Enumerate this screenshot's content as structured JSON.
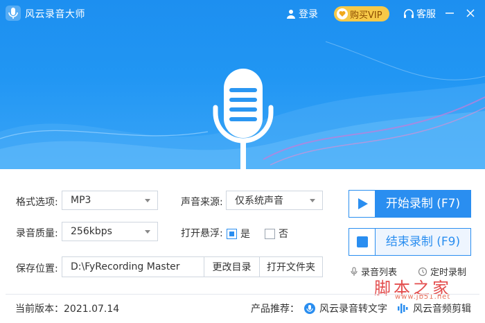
{
  "app": {
    "title": "风云录音大师",
    "login_label": "登录",
    "vip_label": "购买VIP",
    "service_label": "客服"
  },
  "form": {
    "format_label": "格式选项:",
    "format_value": "MP3",
    "quality_label": "录音质量:",
    "quality_value": "256kbps",
    "source_label": "声音来源:",
    "source_value": "仅系统声音",
    "float_label": "打开悬浮:",
    "float_yes": "是",
    "float_no": "否",
    "float_selected": "是",
    "save_label": "保存位置:",
    "save_path": "D:\\FyRecording Master",
    "change_dir_label": "更改目录",
    "open_folder_label": "打开文件夹"
  },
  "actions": {
    "start_label": "开始录制 (F7)",
    "stop_label": "结束录制 (F9)",
    "list_label": "录音列表",
    "timer_label": "定时录制"
  },
  "footer": {
    "version_text": "当前版本：2021.07.14",
    "recommend_label": "产品推荐：",
    "product1": "风云录音转文字",
    "product2": "风云音频剪辑"
  },
  "watermark": {
    "text": "脚本之家",
    "url": "www.jb51.net"
  },
  "colors": {
    "accent": "#2a8ef0",
    "header": "#2196f3",
    "vip": "#f7c948"
  }
}
